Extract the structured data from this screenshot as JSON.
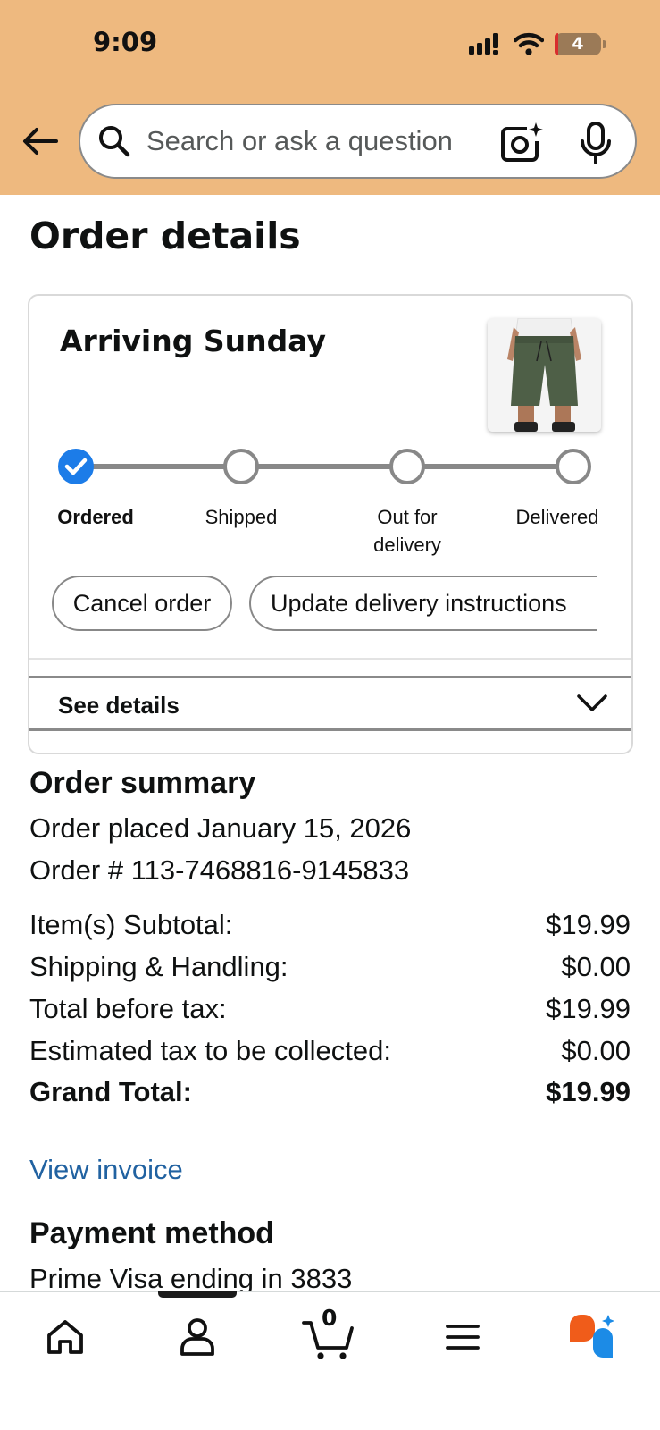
{
  "status_bar": {
    "time": "9:09",
    "battery": "4"
  },
  "search": {
    "placeholder": "Search or ask a question"
  },
  "page": {
    "title": "Order details"
  },
  "delivery_card": {
    "heading": "Arriving Sunday",
    "steps": [
      {
        "label": "Ordered",
        "done": true
      },
      {
        "label": "Shipped",
        "done": false
      },
      {
        "label": "Out for\ndelivery",
        "done": false
      },
      {
        "label": "Delivered",
        "done": false
      }
    ],
    "actions": {
      "cancel": "Cancel order",
      "update": "Update delivery instructions"
    },
    "see_details": "See details"
  },
  "order_summary": {
    "title": "Order summary",
    "placed": "Order placed January 15, 2026",
    "order_number": "Order # 113-7468816-9145833",
    "rows": [
      {
        "label": "Item(s) Subtotal:",
        "value": "$19.99"
      },
      {
        "label": "Shipping & Handling:",
        "value": "$0.00"
      },
      {
        "label": "Total before tax:",
        "value": "$19.99"
      },
      {
        "label": "Estimated tax to be collected:",
        "value": "$0.00"
      },
      {
        "label": "Grand Total:",
        "value": "$19.99"
      }
    ],
    "view_invoice": "View invoice"
  },
  "payment": {
    "title": "Payment method",
    "method": "Prime Visa ending in 3833"
  },
  "bottom_nav": {
    "cart_count": "0"
  },
  "colors": {
    "header_bg": "#eeb97f",
    "link": "#2162a1",
    "step_done": "#1c7ce8",
    "assistant_orange": "#f05c1a",
    "assistant_blue": "#1c8be6"
  }
}
